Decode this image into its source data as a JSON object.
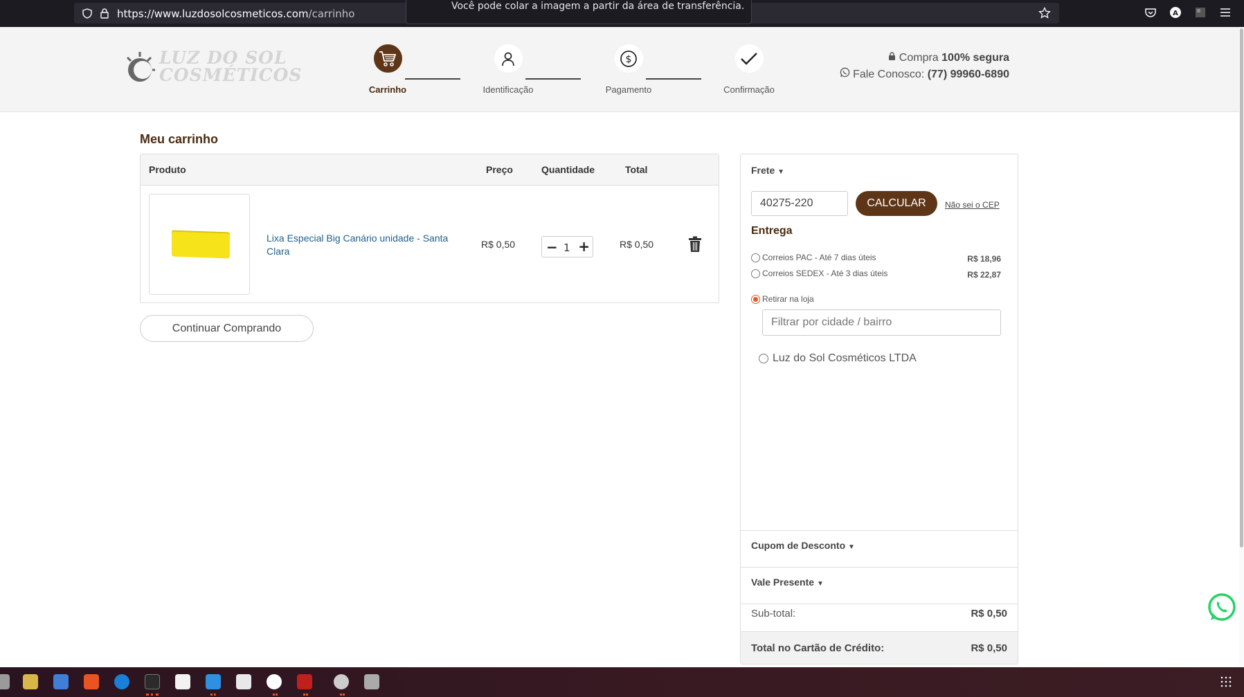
{
  "browser": {
    "url_host": "https://www.luzdosolcosmeticos.com",
    "url_path": "/carrinho",
    "notice": "Você pode colar a imagem a partir da área de transferência."
  },
  "header": {
    "logo_text_line1": "LUZ DO SOL",
    "logo_text_line2": "COSMÉTICOS",
    "steps": [
      {
        "label": "Carrinho",
        "active": true,
        "icon": "cart-icon"
      },
      {
        "label": "Identificação",
        "active": false,
        "icon": "user-icon"
      },
      {
        "label": "Pagamento",
        "active": false,
        "icon": "dollar-icon"
      },
      {
        "label": "Confirmação",
        "active": false,
        "icon": "check-icon"
      }
    ],
    "secure_prefix": "Compra",
    "secure_bold": "100% segura",
    "contact_prefix": "Fale Conosco:",
    "contact_phone": "(77) 99960-6890"
  },
  "cart": {
    "title": "Meu carrinho",
    "columns": {
      "product": "Produto",
      "price": "Preço",
      "quantity": "Quantidade",
      "total": "Total"
    },
    "items": [
      {
        "name": "Lixa Especial Big Canário unidade - Santa Clara",
        "price": "R$ 0,50",
        "quantity": "1",
        "total": "R$ 0,50"
      }
    ],
    "continue_label": "Continuar Comprando"
  },
  "shipping": {
    "frete_label": "Frete",
    "cep_value": "40275-220",
    "calculate_label": "CALCULAR",
    "dont_know_cep": "Não sei o CEP",
    "delivery_title": "Entrega",
    "options": [
      {
        "label": "Correios PAC - Até 7 dias úteis",
        "price": "R$ 18,96",
        "selected": false
      },
      {
        "label": "Correios SEDEX - Até 3 dias úteis",
        "price": "R$ 22,87",
        "selected": false
      }
    ],
    "pickup_label": "Retirar na loja",
    "pickup_selected": true,
    "filter_placeholder": "Filtrar por cidade / bairro",
    "store_name": "Luz do Sol Cosméticos LTDA"
  },
  "summary": {
    "coupon_label": "Cupom de Desconto",
    "gift_label": "Vale Presente",
    "subtotal_label": "Sub-total:",
    "subtotal_value": "R$ 0,50",
    "total_label": "Total no Cartão de Crédito:",
    "total_value": "R$ 0,50"
  },
  "colors": {
    "brand_brown": "#5e3617",
    "radio_accent": "#e25b26",
    "link_blue": "#1f5f8b"
  }
}
